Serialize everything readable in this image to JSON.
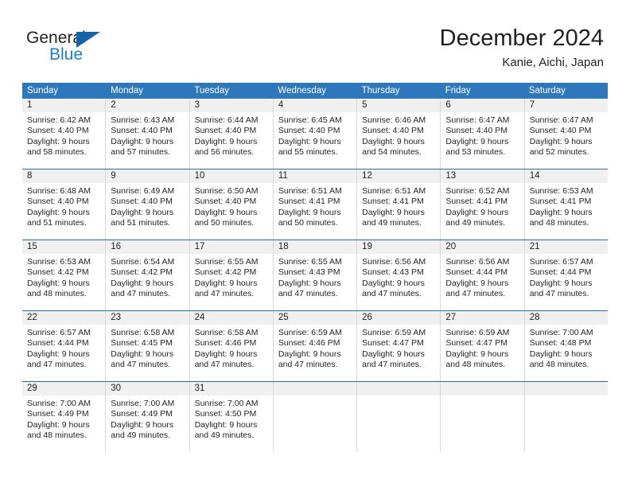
{
  "brand": {
    "name_part1": "General",
    "name_part2": "Blue",
    "triangle_color": "#1464aa",
    "blue_text_color": "#1b7fd4"
  },
  "header": {
    "month_title": "December 2024",
    "location": "Kanie, Aichi, Japan"
  },
  "theme": {
    "header_row_bg": "#2e77bb",
    "row_divider": "#2e6da4",
    "day_number_bg": "#f0f0f0",
    "cell_border": "#d8d8d8",
    "text": "#231f20"
  },
  "calendar": {
    "weekdays": [
      "Sunday",
      "Monday",
      "Tuesday",
      "Wednesday",
      "Thursday",
      "Friday",
      "Saturday"
    ],
    "weeks": [
      {
        "days": [
          {
            "number": "1",
            "sunrise": "Sunrise: 6:42 AM",
            "sunset": "Sunset: 4:40 PM",
            "daylight_line1": "Daylight: 9 hours",
            "daylight_line2": "and 58 minutes."
          },
          {
            "number": "2",
            "sunrise": "Sunrise: 6:43 AM",
            "sunset": "Sunset: 4:40 PM",
            "daylight_line1": "Daylight: 9 hours",
            "daylight_line2": "and 57 minutes."
          },
          {
            "number": "3",
            "sunrise": "Sunrise: 6:44 AM",
            "sunset": "Sunset: 4:40 PM",
            "daylight_line1": "Daylight: 9 hours",
            "daylight_line2": "and 56 minutes."
          },
          {
            "number": "4",
            "sunrise": "Sunrise: 6:45 AM",
            "sunset": "Sunset: 4:40 PM",
            "daylight_line1": "Daylight: 9 hours",
            "daylight_line2": "and 55 minutes."
          },
          {
            "number": "5",
            "sunrise": "Sunrise: 6:46 AM",
            "sunset": "Sunset: 4:40 PM",
            "daylight_line1": "Daylight: 9 hours",
            "daylight_line2": "and 54 minutes."
          },
          {
            "number": "6",
            "sunrise": "Sunrise: 6:47 AM",
            "sunset": "Sunset: 4:40 PM",
            "daylight_line1": "Daylight: 9 hours",
            "daylight_line2": "and 53 minutes."
          },
          {
            "number": "7",
            "sunrise": "Sunrise: 6:47 AM",
            "sunset": "Sunset: 4:40 PM",
            "daylight_line1": "Daylight: 9 hours",
            "daylight_line2": "and 52 minutes."
          }
        ]
      },
      {
        "days": [
          {
            "number": "8",
            "sunrise": "Sunrise: 6:48 AM",
            "sunset": "Sunset: 4:40 PM",
            "daylight_line1": "Daylight: 9 hours",
            "daylight_line2": "and 51 minutes."
          },
          {
            "number": "9",
            "sunrise": "Sunrise: 6:49 AM",
            "sunset": "Sunset: 4:40 PM",
            "daylight_line1": "Daylight: 9 hours",
            "daylight_line2": "and 51 minutes."
          },
          {
            "number": "10",
            "sunrise": "Sunrise: 6:50 AM",
            "sunset": "Sunset: 4:40 PM",
            "daylight_line1": "Daylight: 9 hours",
            "daylight_line2": "and 50 minutes."
          },
          {
            "number": "11",
            "sunrise": "Sunrise: 6:51 AM",
            "sunset": "Sunset: 4:41 PM",
            "daylight_line1": "Daylight: 9 hours",
            "daylight_line2": "and 50 minutes."
          },
          {
            "number": "12",
            "sunrise": "Sunrise: 6:51 AM",
            "sunset": "Sunset: 4:41 PM",
            "daylight_line1": "Daylight: 9 hours",
            "daylight_line2": "and 49 minutes."
          },
          {
            "number": "13",
            "sunrise": "Sunrise: 6:52 AM",
            "sunset": "Sunset: 4:41 PM",
            "daylight_line1": "Daylight: 9 hours",
            "daylight_line2": "and 49 minutes."
          },
          {
            "number": "14",
            "sunrise": "Sunrise: 6:53 AM",
            "sunset": "Sunset: 4:41 PM",
            "daylight_line1": "Daylight: 9 hours",
            "daylight_line2": "and 48 minutes."
          }
        ]
      },
      {
        "days": [
          {
            "number": "15",
            "sunrise": "Sunrise: 6:53 AM",
            "sunset": "Sunset: 4:42 PM",
            "daylight_line1": "Daylight: 9 hours",
            "daylight_line2": "and 48 minutes."
          },
          {
            "number": "16",
            "sunrise": "Sunrise: 6:54 AM",
            "sunset": "Sunset: 4:42 PM",
            "daylight_line1": "Daylight: 9 hours",
            "daylight_line2": "and 47 minutes."
          },
          {
            "number": "17",
            "sunrise": "Sunrise: 6:55 AM",
            "sunset": "Sunset: 4:42 PM",
            "daylight_line1": "Daylight: 9 hours",
            "daylight_line2": "and 47 minutes."
          },
          {
            "number": "18",
            "sunrise": "Sunrise: 6:55 AM",
            "sunset": "Sunset: 4:43 PM",
            "daylight_line1": "Daylight: 9 hours",
            "daylight_line2": "and 47 minutes."
          },
          {
            "number": "19",
            "sunrise": "Sunrise: 6:56 AM",
            "sunset": "Sunset: 4:43 PM",
            "daylight_line1": "Daylight: 9 hours",
            "daylight_line2": "and 47 minutes."
          },
          {
            "number": "20",
            "sunrise": "Sunrise: 6:56 AM",
            "sunset": "Sunset: 4:44 PM",
            "daylight_line1": "Daylight: 9 hours",
            "daylight_line2": "and 47 minutes."
          },
          {
            "number": "21",
            "sunrise": "Sunrise: 6:57 AM",
            "sunset": "Sunset: 4:44 PM",
            "daylight_line1": "Daylight: 9 hours",
            "daylight_line2": "and 47 minutes."
          }
        ]
      },
      {
        "days": [
          {
            "number": "22",
            "sunrise": "Sunrise: 6:57 AM",
            "sunset": "Sunset: 4:44 PM",
            "daylight_line1": "Daylight: 9 hours",
            "daylight_line2": "and 47 minutes."
          },
          {
            "number": "23",
            "sunrise": "Sunrise: 6:58 AM",
            "sunset": "Sunset: 4:45 PM",
            "daylight_line1": "Daylight: 9 hours",
            "daylight_line2": "and 47 minutes."
          },
          {
            "number": "24",
            "sunrise": "Sunrise: 6:58 AM",
            "sunset": "Sunset: 4:46 PM",
            "daylight_line1": "Daylight: 9 hours",
            "daylight_line2": "and 47 minutes."
          },
          {
            "number": "25",
            "sunrise": "Sunrise: 6:59 AM",
            "sunset": "Sunset: 4:46 PM",
            "daylight_line1": "Daylight: 9 hours",
            "daylight_line2": "and 47 minutes."
          },
          {
            "number": "26",
            "sunrise": "Sunrise: 6:59 AM",
            "sunset": "Sunset: 4:47 PM",
            "daylight_line1": "Daylight: 9 hours",
            "daylight_line2": "and 47 minutes."
          },
          {
            "number": "27",
            "sunrise": "Sunrise: 6:59 AM",
            "sunset": "Sunset: 4:47 PM",
            "daylight_line1": "Daylight: 9 hours",
            "daylight_line2": "and 48 minutes."
          },
          {
            "number": "28",
            "sunrise": "Sunrise: 7:00 AM",
            "sunset": "Sunset: 4:48 PM",
            "daylight_line1": "Daylight: 9 hours",
            "daylight_line2": "and 48 minutes."
          }
        ]
      },
      {
        "days": [
          {
            "number": "29",
            "sunrise": "Sunrise: 7:00 AM",
            "sunset": "Sunset: 4:49 PM",
            "daylight_line1": "Daylight: 9 hours",
            "daylight_line2": "and 48 minutes."
          },
          {
            "number": "30",
            "sunrise": "Sunrise: 7:00 AM",
            "sunset": "Sunset: 4:49 PM",
            "daylight_line1": "Daylight: 9 hours",
            "daylight_line2": "and 49 minutes."
          },
          {
            "number": "31",
            "sunrise": "Sunrise: 7:00 AM",
            "sunset": "Sunset: 4:50 PM",
            "daylight_line1": "Daylight: 9 hours",
            "daylight_line2": "and 49 minutes."
          },
          {
            "number": "",
            "sunrise": "",
            "sunset": "",
            "daylight_line1": "",
            "daylight_line2": ""
          },
          {
            "number": "",
            "sunrise": "",
            "sunset": "",
            "daylight_line1": "",
            "daylight_line2": ""
          },
          {
            "number": "",
            "sunrise": "",
            "sunset": "",
            "daylight_line1": "",
            "daylight_line2": ""
          },
          {
            "number": "",
            "sunrise": "",
            "sunset": "",
            "daylight_line1": "",
            "daylight_line2": ""
          }
        ]
      }
    ]
  }
}
